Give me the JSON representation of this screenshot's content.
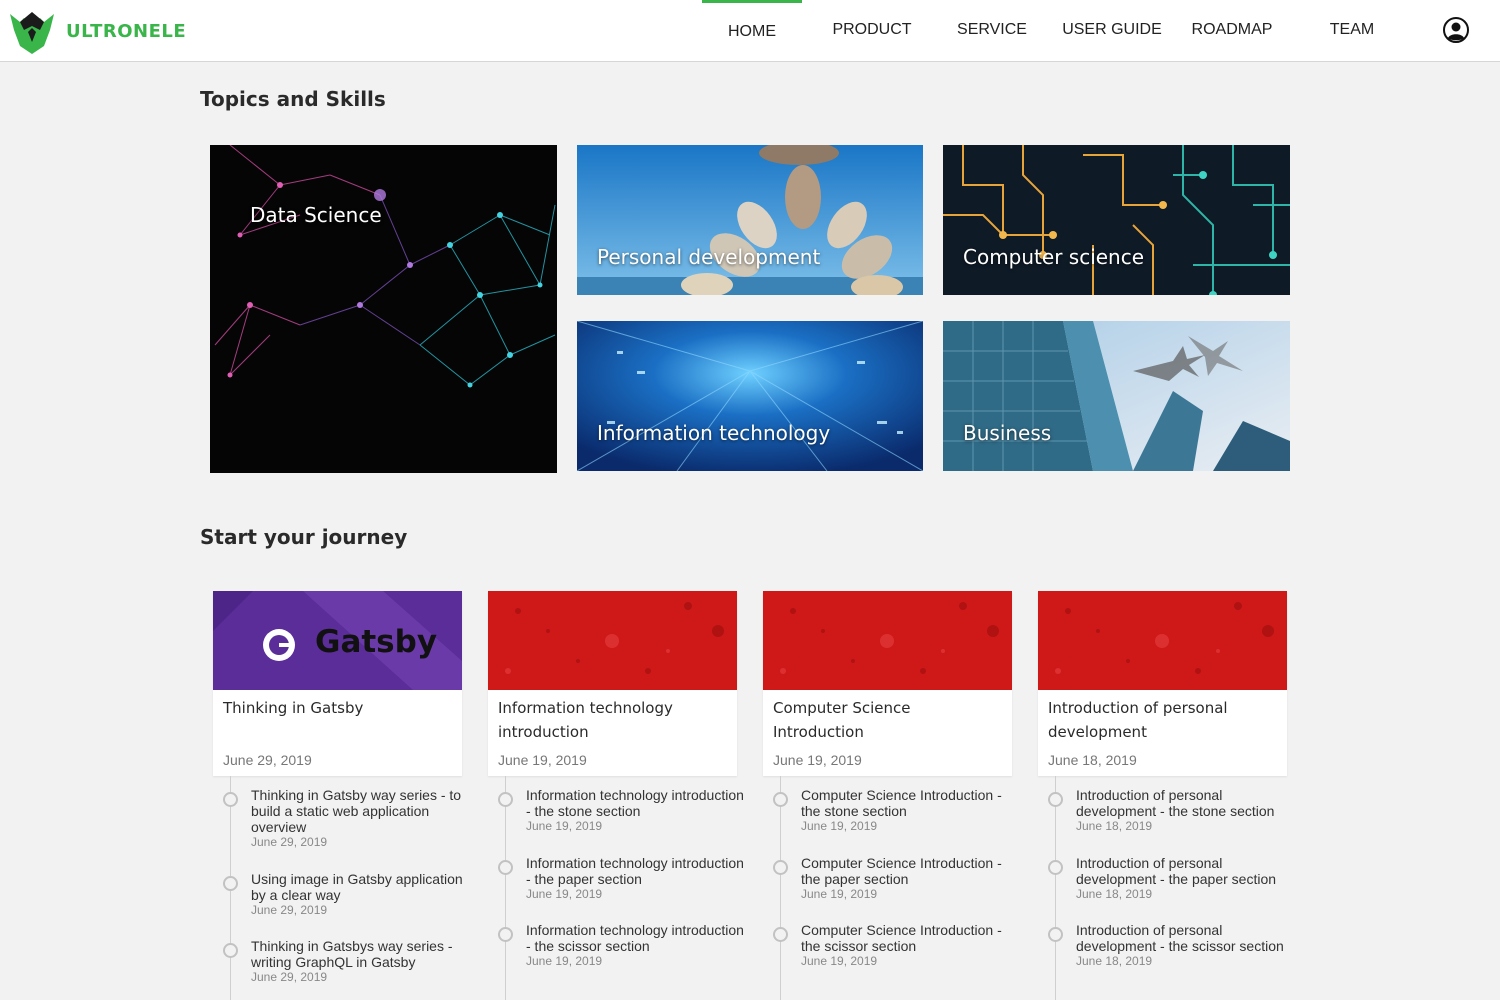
{
  "brand": {
    "name": "ULTRONELE",
    "color": "#39b54a"
  },
  "nav": {
    "items": [
      {
        "label": "HOME",
        "active": true
      },
      {
        "label": "PRODUCT"
      },
      {
        "label": "SERVICE"
      },
      {
        "label": "USER GUIDE"
      },
      {
        "label": "ROADMAP"
      },
      {
        "label": "TEAM"
      }
    ],
    "user_icon": "user-circle-icon"
  },
  "topics": {
    "title": "Topics and Skills",
    "tiles": [
      {
        "label": "Data Science"
      },
      {
        "label": "Personal development"
      },
      {
        "label": "Computer science"
      },
      {
        "label": "Information technology"
      },
      {
        "label": "Business"
      }
    ]
  },
  "journey": {
    "title": "Start your journey",
    "cards": [
      {
        "image_text": "Gatsby",
        "title": "Thinking in Gatsby",
        "date": "June 29, 2019",
        "posts": [
          {
            "title": "Thinking in Gatsby way series - to build a static web application overview",
            "date": "June 29, 2019"
          },
          {
            "title": "Using image in Gatsby application by a clear way",
            "date": "June 29, 2019"
          },
          {
            "title": "Thinking in Gatsbys way series - writing GraphQL in Gatsby",
            "date": "June 29, 2019"
          }
        ]
      },
      {
        "title": "Information technology introduction",
        "date": "June 19, 2019",
        "posts": [
          {
            "title": "Information technology introduction - the stone section",
            "date": "June 19, 2019"
          },
          {
            "title": "Information technology introduction - the paper section",
            "date": "June 19, 2019"
          },
          {
            "title": "Information technology introduction - the scissor section",
            "date": "June 19, 2019"
          }
        ]
      },
      {
        "title": "Computer Science Introduction",
        "date": "June 19, 2019",
        "posts": [
          {
            "title": "Computer Science Introduction - the stone section",
            "date": "June 19, 2019"
          },
          {
            "title": "Computer Science Introduction - the paper section",
            "date": "June 19, 2019"
          },
          {
            "title": "Computer Science Introduction - the scissor section",
            "date": "June 19, 2019"
          }
        ]
      },
      {
        "title": "Introduction of personal development",
        "date": "June 18, 2019",
        "posts": [
          {
            "title": "Introduction of personal development - the stone section",
            "date": "June 18, 2019"
          },
          {
            "title": "Introduction of personal development - the paper section",
            "date": "June 18, 2019"
          },
          {
            "title": "Introduction of personal development - the scissor section",
            "date": "June 18, 2019"
          }
        ]
      }
    ]
  }
}
